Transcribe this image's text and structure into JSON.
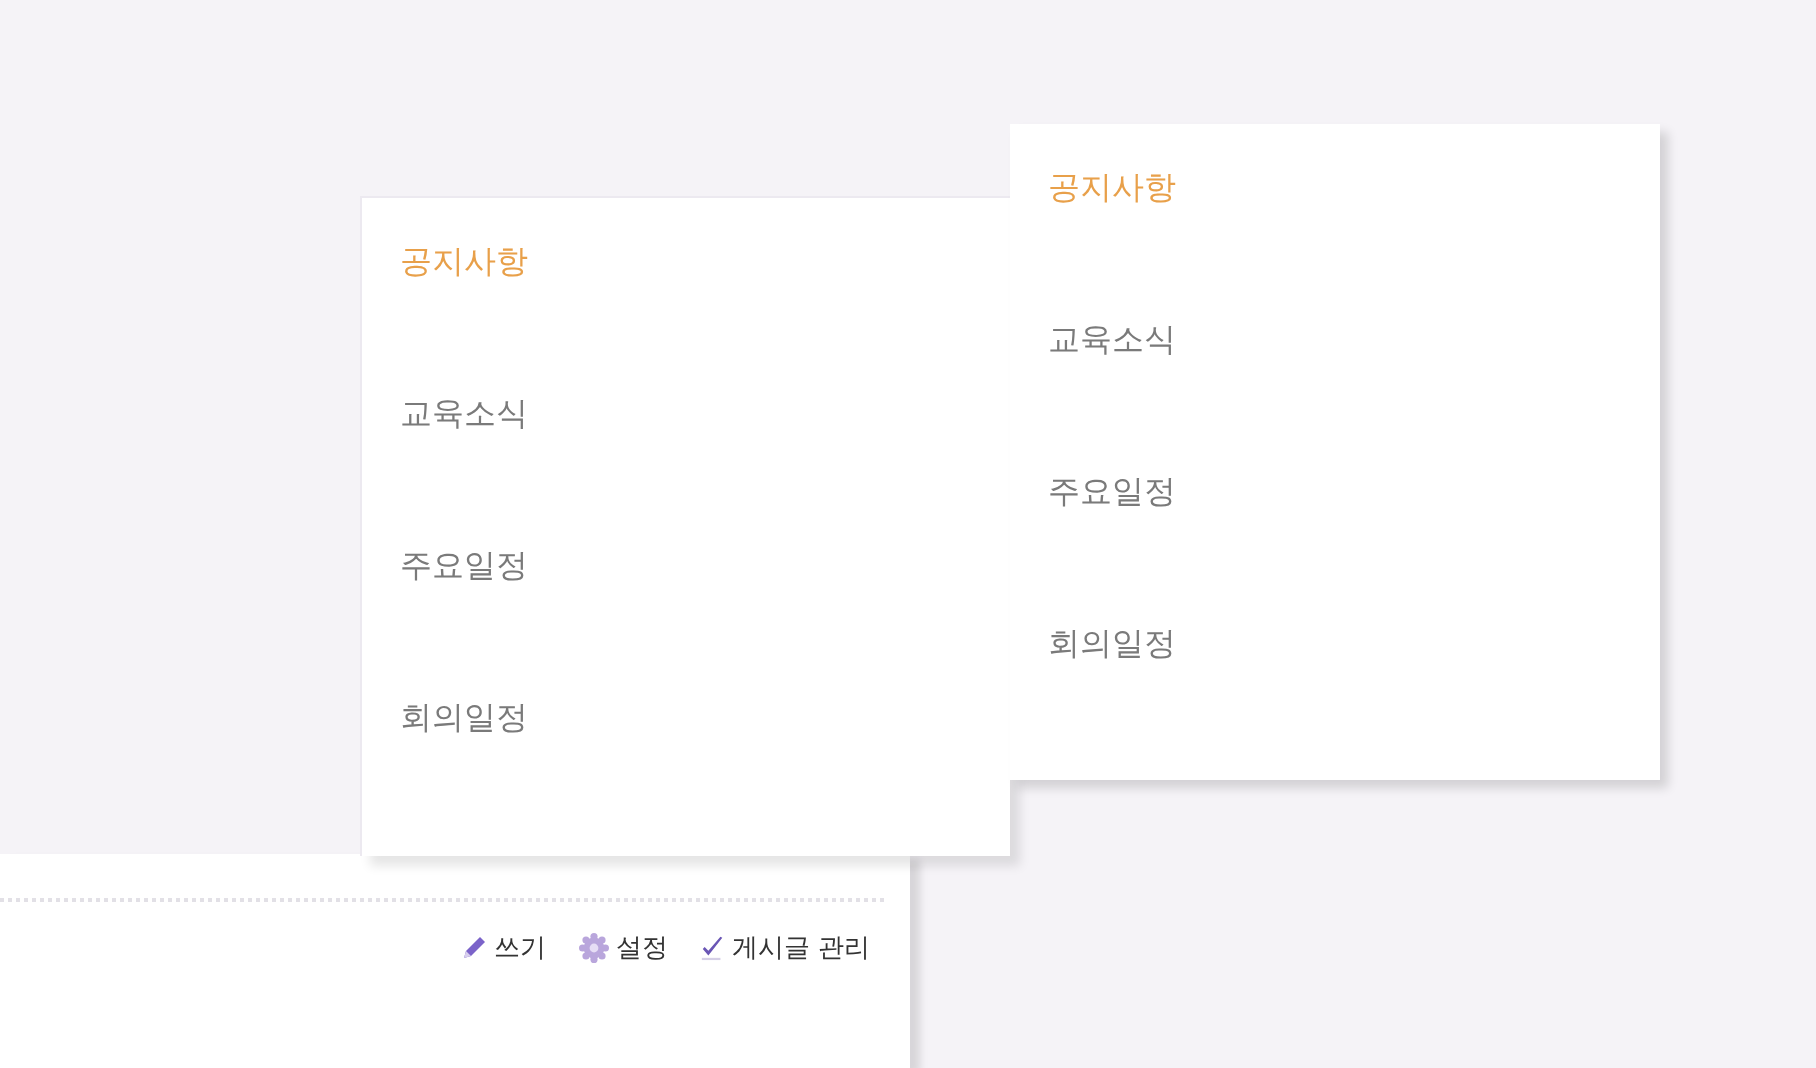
{
  "menus": [
    {
      "items": [
        {
          "label": "공지사항",
          "selected": true
        },
        {
          "label": "교육소식",
          "selected": false
        },
        {
          "label": "주요일정",
          "selected": false
        },
        {
          "label": "회의일정",
          "selected": false
        }
      ]
    },
    {
      "items": [
        {
          "label": "공지사항",
          "selected": true
        },
        {
          "label": "교육소식",
          "selected": false
        },
        {
          "label": "주요일정",
          "selected": false
        },
        {
          "label": "회의일정",
          "selected": false
        }
      ]
    }
  ],
  "toolbar": [
    {
      "kind": "write",
      "label": "쓰기"
    },
    {
      "kind": "settings",
      "label": "설정"
    },
    {
      "kind": "manage",
      "label": "게시글 관리"
    }
  ]
}
